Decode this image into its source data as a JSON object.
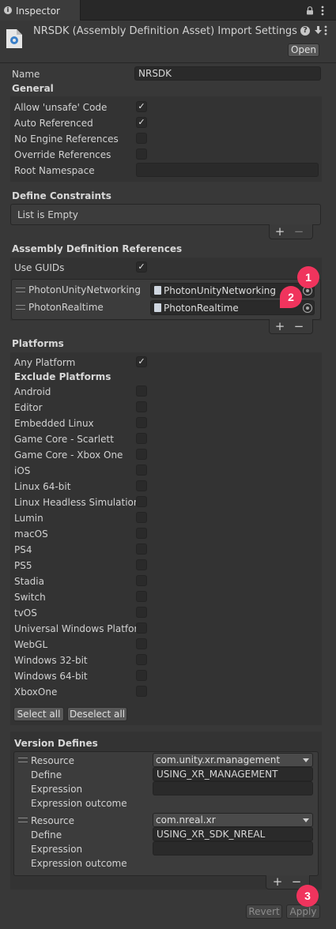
{
  "tab": {
    "title": "Inspector"
  },
  "header": {
    "title": "NRSDK (Assembly Definition Asset) Import Settings",
    "open_label": "Open"
  },
  "name_field": {
    "label": "Name",
    "value": "NRSDK"
  },
  "general": {
    "title": "General",
    "rows": [
      {
        "label": "Allow 'unsafe' Code",
        "checked": "✓"
      },
      {
        "label": "Auto Referenced",
        "checked": "✓"
      },
      {
        "label": "No Engine References",
        "checked": ""
      },
      {
        "label": "Override References",
        "checked": ""
      }
    ],
    "root_namespace_label": "Root Namespace",
    "root_namespace_value": ""
  },
  "define_constraints": {
    "title": "Define Constraints",
    "empty_text": "List is Empty",
    "plus": "+",
    "minus": "−"
  },
  "assembly_refs": {
    "title": "Assembly Definition References",
    "use_guids_label": "Use GUIDs",
    "use_guids_checked": "✓",
    "items": [
      {
        "label": "PhotonUnityNetworking",
        "value": "PhotonUnityNetworking"
      },
      {
        "label": "PhotonRealtime",
        "value": "PhotonRealtime"
      }
    ],
    "plus": "+",
    "minus": "−"
  },
  "platforms": {
    "title": "Platforms",
    "any_platform_label": "Any Platform",
    "any_platform_checked": "✓",
    "exclude_title": "Exclude Platforms",
    "items": [
      "Android",
      "Editor",
      "Embedded Linux",
      "Game Core - Scarlett",
      "Game Core - Xbox One",
      "iOS",
      "Linux 64-bit",
      "Linux Headless Simulation",
      "Lumin",
      "macOS",
      "PS4",
      "PS5",
      "Stadia",
      "Switch",
      "tvOS",
      "Universal Windows Platform",
      "WebGL",
      "Windows 32-bit",
      "Windows 64-bit",
      "XboxOne"
    ],
    "select_all": "Select all",
    "deselect_all": "Deselect all"
  },
  "version_defines": {
    "title": "Version Defines",
    "entries": [
      {
        "resource_label": "Resource",
        "resource": "com.unity.xr.management",
        "define_label": "Define",
        "define": "USING_XR_MANAGEMENT",
        "expression_label": "Expression",
        "expression": "",
        "outcome_label": "Expression outcome",
        "outcome": ""
      },
      {
        "resource_label": "Resource",
        "resource": "com.nreal.xr",
        "define_label": "Define",
        "define": "USING_XR_SDK_NREAL",
        "expression_label": "Expression",
        "expression": "",
        "outcome_label": "Expression outcome",
        "outcome": ""
      }
    ],
    "plus": "+",
    "minus": "−"
  },
  "footer": {
    "revert": "Revert",
    "apply": "Apply"
  },
  "badges": [
    "1",
    "2",
    "3"
  ],
  "colors": {
    "badge": "#f0345d",
    "background": "#383838",
    "field": "#2a2a2a"
  },
  "icons": [
    "info-icon",
    "lock-icon",
    "kebab-menu-icon",
    "assembly-definition-icon",
    "help-icon",
    "settings-icon",
    "drag-handle-icon",
    "object-picker-icon",
    "dropdown-arrow-icon"
  ]
}
